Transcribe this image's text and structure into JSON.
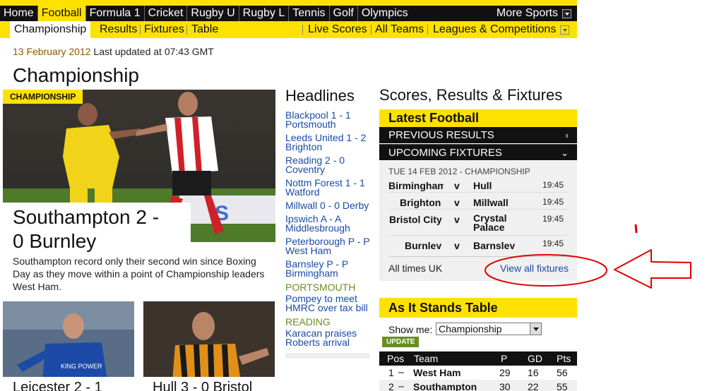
{
  "topnav": {
    "items": [
      "Home",
      "Football",
      "Formula 1",
      "Cricket",
      "Rugby U",
      "Rugby L",
      "Tennis",
      "Golf",
      "Olympics"
    ],
    "active": "Football",
    "more": "More Sports"
  },
  "subnav": {
    "left": [
      "Championship",
      "Results",
      "Fixtures",
      "Table"
    ],
    "right": [
      "Live Scores",
      "All Teams",
      "Leagues & Competitions"
    ]
  },
  "page": {
    "date": "13 February 2012",
    "updated": "Last updated at 07:43 GMT",
    "title": "Championship"
  },
  "lead": {
    "tag": "CHAMPIONSHIP",
    "headline_line1": "Southampton 2 -",
    "headline_line2": "0 Burnley",
    "summary": "Southampton record only their second win since Boxing Day as they move within a point of Championship leaders West Ham."
  },
  "stories": {
    "left_caption": "Leicester 2 - 1",
    "right_caption": "Hull 3 - 0 Bristol"
  },
  "headlines": {
    "title": "Headlines",
    "items": [
      {
        "text": "Blackpool 1 - 1 Portsmouth"
      },
      {
        "text": "Leeds United 1 - 2 Brighton"
      },
      {
        "text": "Reading 2 - 0 Coventry"
      },
      {
        "text": "Nottm Forest 1 - 1 Watford"
      },
      {
        "text": "Millwall 0 - 0 Derby"
      },
      {
        "text": "Ipswich A - A Middlesbrough"
      },
      {
        "text": "Peterborough P - P West Ham"
      },
      {
        "text": "Barnsley P - P Birmingham"
      },
      {
        "section": "PORTSMOUTH",
        "text": "Pompey to meet HMRC over tax bill"
      },
      {
        "section": "READING",
        "text": "Karacan praises Roberts arrival"
      }
    ]
  },
  "scores": {
    "title": "Scores, Results & Fixtures",
    "latest": "Latest Football",
    "previous": "PREVIOUS RESULTS",
    "upcoming": "UPCOMING FIXTURES",
    "fixtures_header": "TUE 14 FEB 2012 - CHAMPIONSHIP",
    "v": "v",
    "fixtures": [
      {
        "home": "Birmingham",
        "away": "Hull",
        "time": "19:45"
      },
      {
        "home": "Brighton",
        "away": "Millwall",
        "time": "19:45"
      },
      {
        "home": "Bristol City",
        "away": "Crystal Palace",
        "time": "19:45"
      },
      {
        "home": "Burnley",
        "away": "Barnsley",
        "time": "19:45"
      }
    ],
    "all_times": "All times UK",
    "view_all": "View all fixtures"
  },
  "table": {
    "title": "As It Stands Table",
    "show_me_label": "Show me:",
    "selected": "Championship",
    "update": "UPDATE",
    "columns": [
      "Pos",
      "Team",
      "P",
      "GD",
      "Pts"
    ],
    "rows": [
      {
        "pos": "1",
        "team": "West Ham",
        "p": "29",
        "gd": "16",
        "pts": "56"
      },
      {
        "pos": "2",
        "team": "Southampton",
        "p": "30",
        "gd": "22",
        "pts": "55"
      }
    ]
  },
  "colors": {
    "brand_yellow": "#ffe100",
    "nav_black": "#111111",
    "link_blue": "#1a4aa8",
    "section_green": "#6b8e23",
    "annotation_red": "#e00000"
  }
}
